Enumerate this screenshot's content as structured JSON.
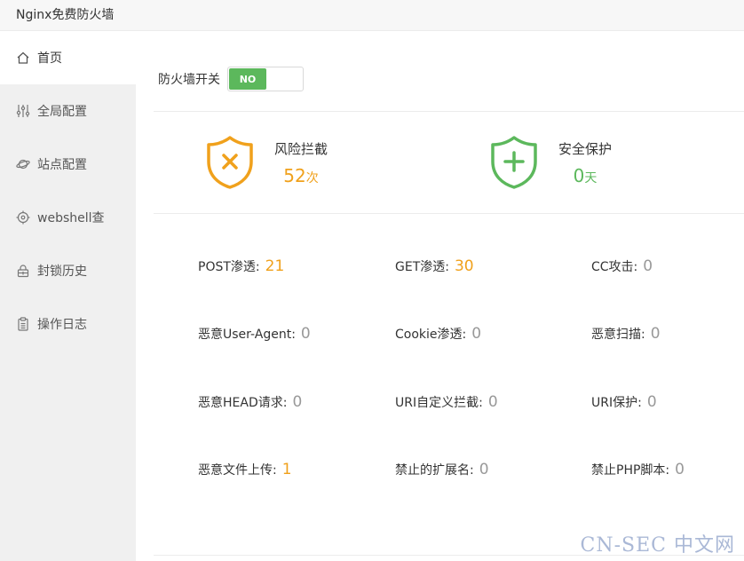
{
  "app": {
    "title": "Nginx免费防火墙"
  },
  "sidebar": {
    "items": [
      {
        "label": "首页",
        "icon": "home-icon"
      },
      {
        "label": "全局配置",
        "icon": "sliders-icon"
      },
      {
        "label": "站点配置",
        "icon": "planet-icon"
      },
      {
        "label": "webshell查",
        "icon": "crosshair-icon"
      },
      {
        "label": "封锁历史",
        "icon": "lock-icon"
      },
      {
        "label": "操作日志",
        "icon": "clipboard-icon"
      }
    ]
  },
  "firewall_switch": {
    "label": "防火墙开关",
    "state": "NO"
  },
  "summary": {
    "risk": {
      "label": "风险拦截",
      "value": "52",
      "unit": "次",
      "color": "#f0a11c"
    },
    "safe": {
      "label": "安全保护",
      "value": "0",
      "unit": "天",
      "color": "#5cb85c"
    }
  },
  "metrics": [
    {
      "label": "POST渗透:",
      "value": "21"
    },
    {
      "label": "GET渗透:",
      "value": "30"
    },
    {
      "label": "CC攻击:",
      "value": "0"
    },
    {
      "label": "恶意User-Agent:",
      "value": "0"
    },
    {
      "label": "Cookie渗透:",
      "value": "0"
    },
    {
      "label": "恶意扫描:",
      "value": "0"
    },
    {
      "label": "恶意HEAD请求:",
      "value": "0"
    },
    {
      "label": "URI自定义拦截:",
      "value": "0"
    },
    {
      "label": "URI保护:",
      "value": "0"
    },
    {
      "label": "恶意文件上传:",
      "value": "1"
    },
    {
      "label": "禁止的扩展名:",
      "value": "0"
    },
    {
      "label": "禁止PHP脚本:",
      "value": "0"
    }
  ],
  "watermark": "CN-SEC 中文网"
}
